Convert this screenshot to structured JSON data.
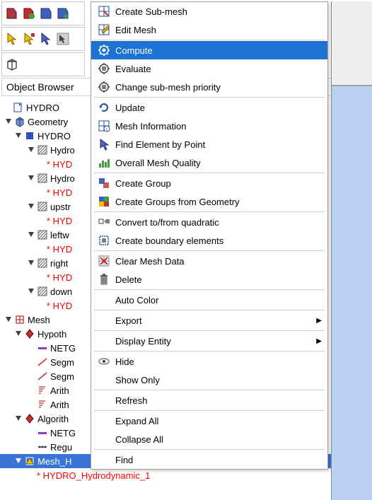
{
  "object_browser_label": "Object Browser",
  "tree": {
    "root": "HYDRO",
    "geometry": "Geometry",
    "hydro": "HYDRO",
    "hydro_hyd": "Hydro",
    "red1": "* HYD",
    "hydro_d": "Hydro",
    "red2": "* HYD",
    "upstr": "upstr",
    "red3": "* HYD",
    "leftw": "leftw",
    "red4": "* HYD",
    "right": "right",
    "red5": "* HYD",
    "down": "down",
    "red6": "* HYD",
    "mesh": "Mesh",
    "hypotheses": "Hypoth",
    "netg1": "NETG",
    "segm1": "Segm",
    "segm2": "Segm",
    "arith1": "Arith",
    "arith2": "Arith",
    "algorithms": "Algorith",
    "netg2": "NETG",
    "regu": "Regu",
    "mesh_hi": "Mesh_H",
    "red_last": "* HYDRO_Hydrodynamic_1"
  },
  "menu": {
    "create_submesh": "Create Sub-mesh",
    "edit_mesh": "Edit Mesh",
    "compute": "Compute",
    "evaluate": "Evaluate",
    "change_priority": "Change sub-mesh priority",
    "update": "Update",
    "mesh_info": "Mesh Information",
    "find_element": "Find Element by Point",
    "overall_quality": "Overall Mesh Quality",
    "create_group": "Create Group",
    "create_groups_geom": "Create Groups from Geometry",
    "convert_quadratic": "Convert to/from quadratic",
    "create_boundary": "Create boundary elements",
    "clear_mesh": "Clear Mesh Data",
    "delete": "Delete",
    "auto_color": "Auto Color",
    "export": "Export",
    "display_entity": "Display Entity",
    "hide": "Hide",
    "show_only": "Show Only",
    "refresh": "Refresh",
    "expand_all": "Expand All",
    "collapse_all": "Collapse All",
    "find": "Find"
  }
}
